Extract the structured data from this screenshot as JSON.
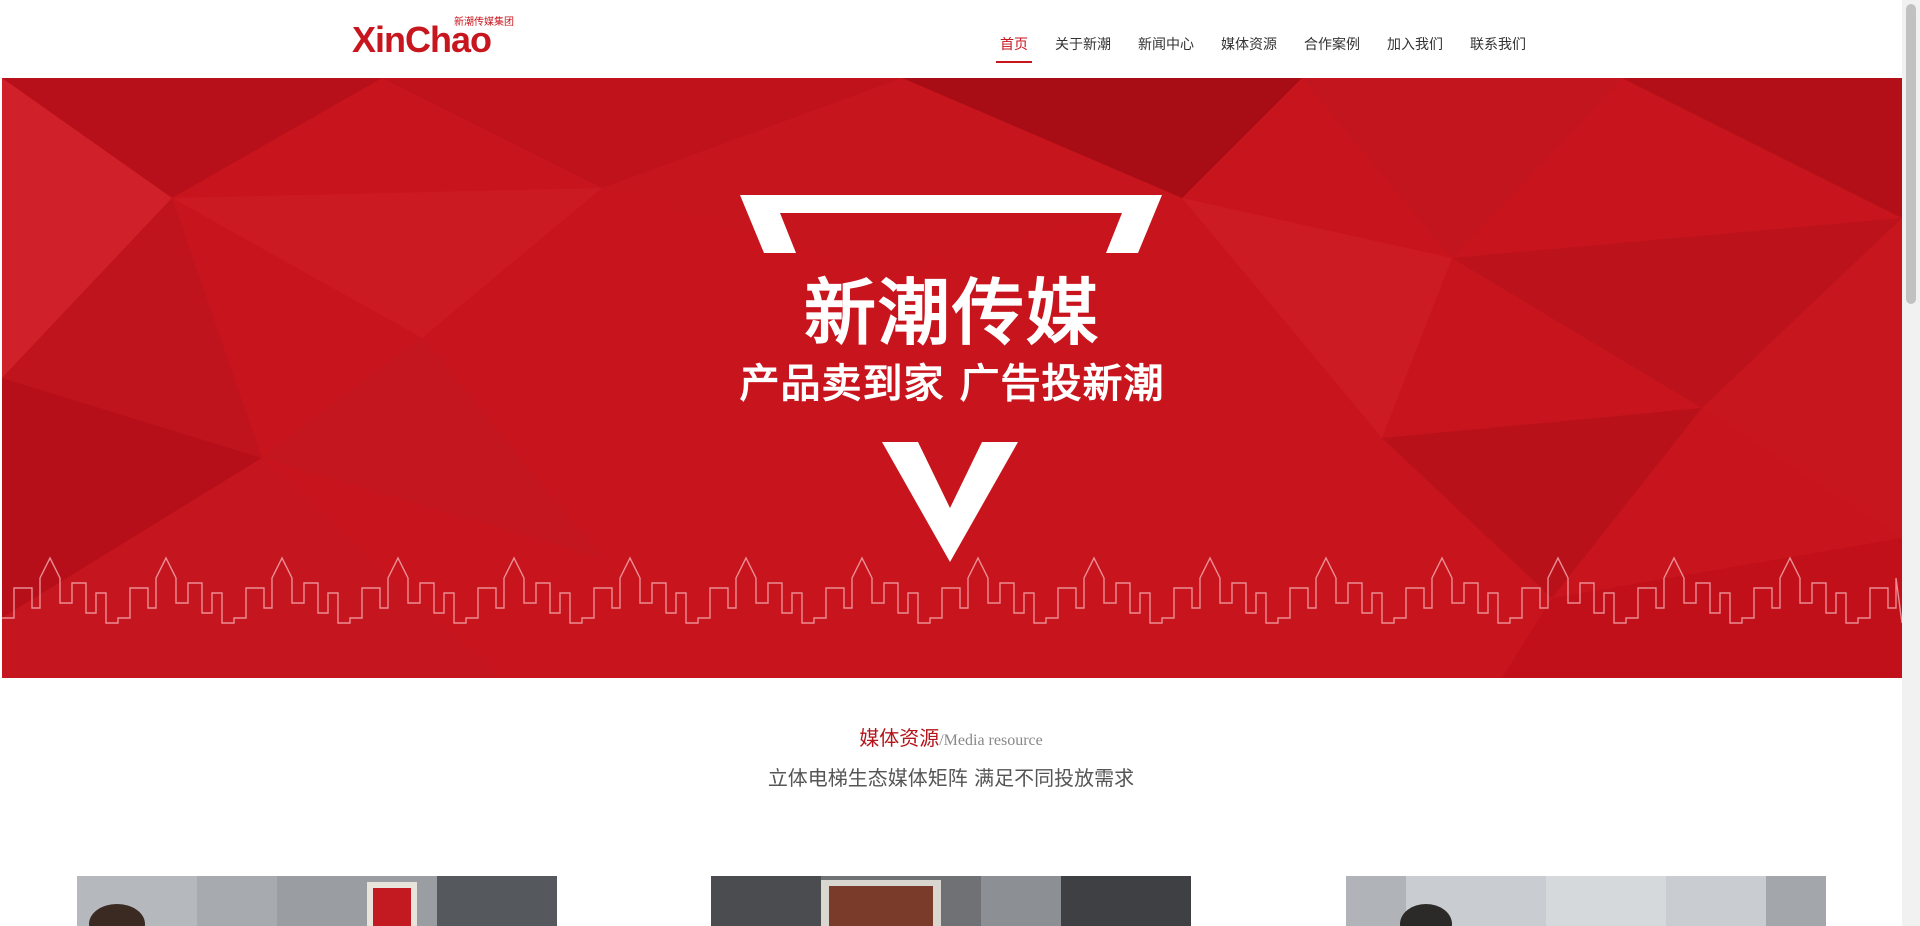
{
  "logo": {
    "text": "XinChao",
    "subtext": "新潮传媒集团"
  },
  "nav": {
    "items": [
      {
        "label": "首页",
        "active": true
      },
      {
        "label": "关于新潮",
        "active": false
      },
      {
        "label": "新闻中心",
        "active": false
      },
      {
        "label": "媒体资源",
        "active": false
      },
      {
        "label": "合作案例",
        "active": false
      },
      {
        "label": "加入我们",
        "active": false
      },
      {
        "label": "联系我们",
        "active": false
      }
    ]
  },
  "banner": {
    "title": "新潮传媒",
    "slogan": "产品卖到家 广告投新潮"
  },
  "media_section": {
    "title_cn": "媒体资源",
    "title_en": "/Media resource",
    "subtitle": "立体电梯生态媒体矩阵 满足不同投放需求"
  },
  "colors": {
    "brand": "#c8161e",
    "banner": "#c8141c"
  }
}
